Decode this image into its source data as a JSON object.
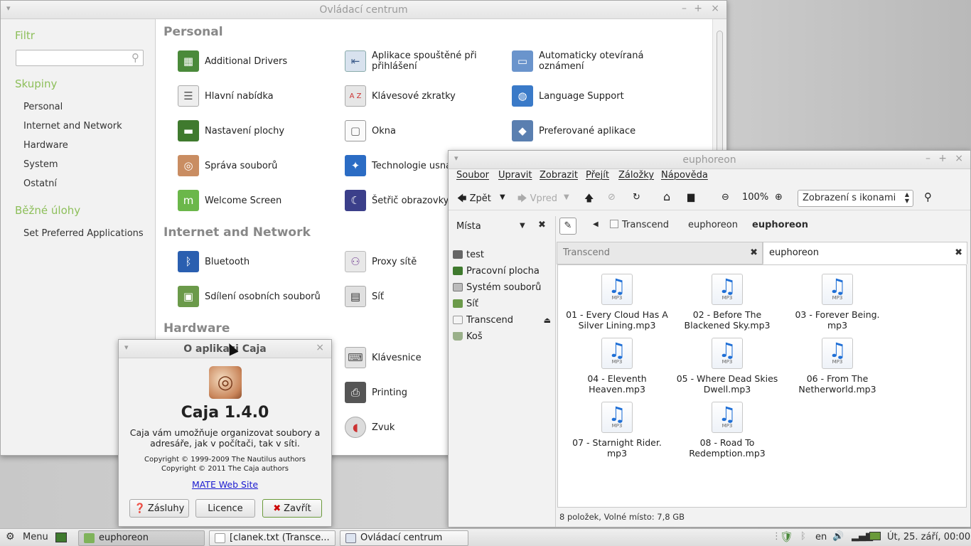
{
  "control_center": {
    "title": "Ovládací centrum",
    "sidebar": {
      "filter_heading": "Filtr",
      "groups_heading": "Skupiny",
      "groups": [
        "Personal",
        "Internet and Network",
        "Hardware",
        "System",
        "Ostatní"
      ],
      "tasks_heading": "Běžné úlohy",
      "tasks": [
        "Set Preferred Applications"
      ]
    },
    "sections": {
      "personal": "Personal",
      "internet": "Internet and Network",
      "hardware": "Hardware"
    },
    "items": {
      "additional_drivers": "Additional Drivers",
      "startup_apps": "Aplikace spouštěné při přihlášení",
      "popup_notifications": "Automaticky otevíraná oznámení",
      "main_menu": "Hlavní nabídka",
      "keyboard_shortcuts": "Klávesové zkratky",
      "language_support": "Language Support",
      "desktop_settings": "Nastavení plochy",
      "windows": "Okna",
      "preferred_apps": "Preferované aplikace",
      "file_management": "Správa souborů",
      "assistive_tech": "Technologie usna",
      "welcome_screen": "Welcome Screen",
      "screensaver": "Šetřič obrazovky",
      "bluetooth": "Bluetooth",
      "proxy": "Proxy sítě",
      "file_sharing": "Sdílení osobních souborů",
      "network": "Síť",
      "keyboard": "Klávesnice",
      "printing": "Printing",
      "sound": "Zvuk"
    }
  },
  "about_dialog": {
    "title": "O aplikaci Caja",
    "app_name": "Caja 1.4.0",
    "description": "Caja vám umožňuje organizovat soubory a adresáře, jak v počítači, tak v síti.",
    "copyright_1": "Copyright © 1999-2009 The Nautilus authors",
    "copyright_2": "Copyright © 2011 The Caja authors",
    "website": "MATE Web Site",
    "credits_button": "Zásluhy",
    "license_button": "Licence",
    "close_button": "Zavřít"
  },
  "caja": {
    "title": "euphoreon",
    "menu": [
      "Soubor",
      "Upravit",
      "Zobrazit",
      "Přejít",
      "Záložky",
      "Nápověda"
    ],
    "toolbar": {
      "back": "Zpět",
      "forward": "Vpred",
      "zoom": "100%",
      "view_mode": "Zobrazení s ikonami"
    },
    "places_heading": "Místa",
    "places": [
      "test",
      "Pracovní plocha",
      "Systém souborů",
      "Síť",
      "Transcend",
      "Koš"
    ],
    "path": [
      "Transcend",
      "euphoreon",
      "euphoreon"
    ],
    "tabs": [
      "Transcend",
      "euphoreon"
    ],
    "files": [
      "01 - Every Cloud Has A Silver Lining.mp3",
      "02 - Before The Blackened Sky.mp3",
      "03 - Forever Being. mp3",
      "04 - Eleventh Heaven.mp3",
      "05 - Where Dead Skies Dwell.mp3",
      "06 - From The Netherworld.mp3",
      "07 - Starnight Rider. mp3",
      "08 - Road To Redemption.mp3"
    ],
    "file_tag": "MP3",
    "status": "8 položek, Volné místo: 7,8 GB"
  },
  "panel": {
    "menu": "Menu",
    "tasks": [
      "euphoreon",
      "[clanek.txt (Transce...",
      "Ovládací centrum"
    ],
    "keyboard_layout": "en",
    "clock": "Út, 25. září, 00:00"
  }
}
